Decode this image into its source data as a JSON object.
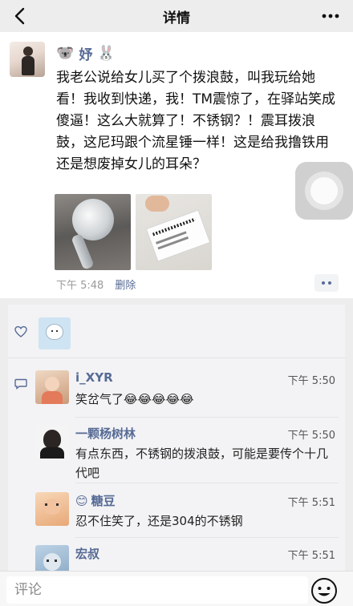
{
  "header": {
    "title": "详情",
    "back_icon": "chevron-left-icon",
    "more_icon": "more-dots-icon"
  },
  "post": {
    "author": "妤",
    "author_emoji_left": "🐨",
    "author_emoji_right": "🐰",
    "text": "我老公说给女儿买了个拨浪鼓，叫我玩给她看！我收到快递，我！TM震惊了，在驿站笑成傻逼！这么大就算了！不锈钢？！震耳拨浪鼓，这尼玛跟个流星锤一样！这是给我撸铁用还是想废掉女儿的耳朵？",
    "time": "下午 5:48",
    "delete_label": "删除"
  },
  "comments": [
    {
      "name": "i_XYR",
      "name_emoji": "",
      "time": "下午 5:50",
      "text": "笑岔气了😂😂😂😂😂"
    },
    {
      "name": "一颗杨树林",
      "name_emoji": "",
      "time": "下午 5:50",
      "text": "有点东西，不锈钢的拨浪鼓，可能是要传个十几代吧"
    },
    {
      "name": "糖豆",
      "name_emoji": "😊",
      "time": "下午 5:51",
      "text": "忍不住笑了，还是304的不锈钢"
    },
    {
      "name": "宏叔",
      "name_emoji": "",
      "time": "下午 5:51",
      "text": ""
    }
  ],
  "footer": {
    "comment_placeholder": "评论",
    "emoji_icon": "smiley-face-icon"
  },
  "colors": {
    "link_blue": "#576b95",
    "background": "#ededed",
    "card": "#ffffff",
    "interaction_bg": "#f3f3f5"
  }
}
